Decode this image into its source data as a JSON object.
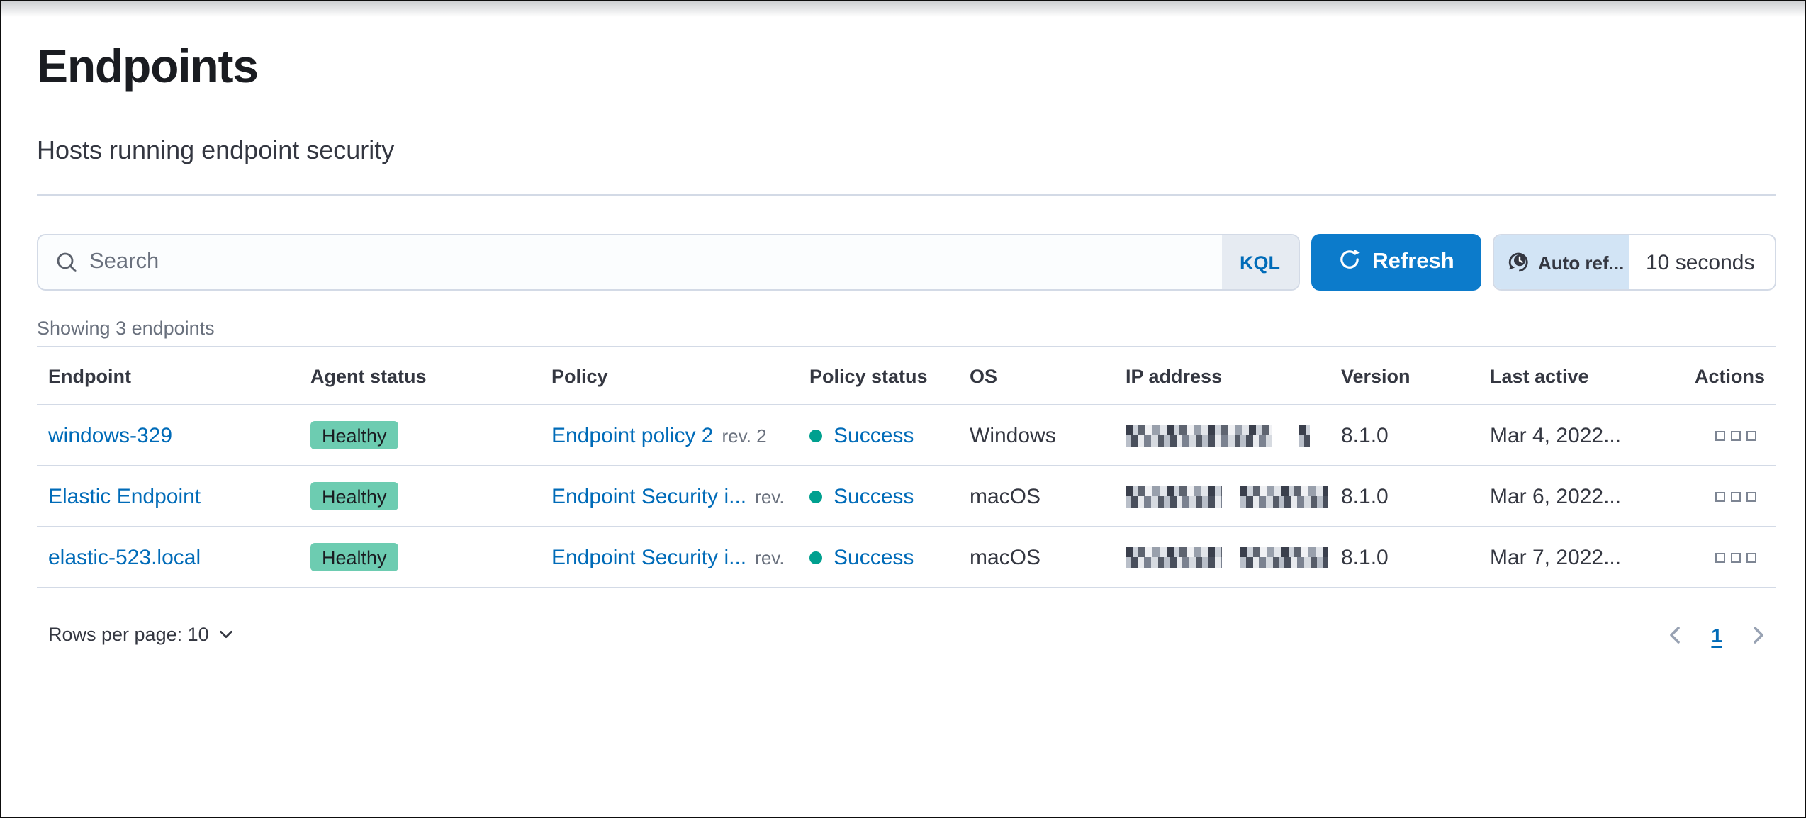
{
  "page": {
    "title": "Endpoints",
    "subtitle": "Hosts running endpoint security"
  },
  "toolbar": {
    "search_placeholder": "Search",
    "kql_label": "KQL",
    "refresh_label": "Refresh",
    "auto_refresh_label": "Auto ref...",
    "auto_refresh_interval": "10 seconds"
  },
  "table": {
    "summary": "Showing 3 endpoints",
    "columns": [
      "Endpoint",
      "Agent status",
      "Policy",
      "Policy status",
      "OS",
      "IP address",
      "Version",
      "Last active",
      "Actions"
    ],
    "rows": [
      {
        "endpoint": "windows-329",
        "agent_status": "Healthy",
        "policy": "Endpoint policy 2",
        "policy_rev": "rev. 2",
        "policy_status": "Success",
        "os": "Windows",
        "ip_redacted": true,
        "version": "8.1.0",
        "last_active": "Mar 4, 2022..."
      },
      {
        "endpoint": "Elastic Endpoint",
        "agent_status": "Healthy",
        "policy": "Endpoint Security i...",
        "policy_rev": "rev.",
        "policy_status": "Success",
        "os": "macOS",
        "ip_redacted": true,
        "version": "8.1.0",
        "last_active": "Mar 6, 2022..."
      },
      {
        "endpoint": "elastic-523.local",
        "agent_status": "Healthy",
        "policy": "Endpoint Security i...",
        "policy_rev": "rev.",
        "policy_status": "Success",
        "os": "macOS",
        "ip_redacted": true,
        "version": "8.1.0",
        "last_active": "Mar 7, 2022..."
      }
    ]
  },
  "pagination": {
    "rows_per_page_label": "Rows per page: 10",
    "current_page": "1"
  },
  "colors": {
    "link_blue": "#006bb8",
    "button_blue": "#0c7bcb",
    "healthy_badge_green": "#6dccb1",
    "success_dot_teal": "#00a08f",
    "border_gray": "#d3dae6",
    "muted_text": "#69707d",
    "body_text": "#343741"
  }
}
